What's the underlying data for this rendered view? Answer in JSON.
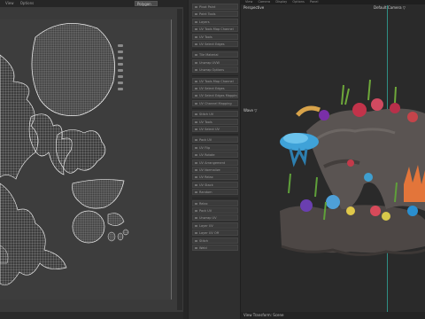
{
  "uv_editor": {
    "menu": [
      "View",
      "Options"
    ],
    "dropdown": "Polygon",
    "color_bg": "#3d3d3d",
    "wire_color": "#d9d9d9"
  },
  "panel": {
    "items": [
      "Pivot Paint",
      "Paint Tools",
      "Layers",
      "UV Tools Map Channel",
      "UV Tools",
      "UV Select Edges",
      "Tile Material",
      "Unwrap UVW",
      "Unwrap Options",
      "UV Tools Map Channel",
      "UV Select Edges",
      "UV Select Edges Mapping",
      "UV Channel Mapping",
      "Stitch UV",
      "UV Tools",
      "UV Select UV",
      "Pack UV",
      "UV Flip",
      "UV Rotate",
      "UV Arrangement",
      "UV Normalize",
      "UV Relax",
      "UV Stack",
      "Random",
      "Relax",
      "Pack UV",
      "Unwrap UV",
      "Layer UV",
      "Layer UV Off",
      "Stitch",
      "Weld"
    ]
  },
  "viewport": {
    "menu": [
      "View",
      "Camera",
      "Display",
      "Options",
      "Panel"
    ],
    "perspective_label": "Perspective",
    "camera_label": "Default Camera ▽",
    "wave_label": "Wave ▽",
    "status_text": "View Transform: Scene",
    "accent": "#2f8f85"
  }
}
